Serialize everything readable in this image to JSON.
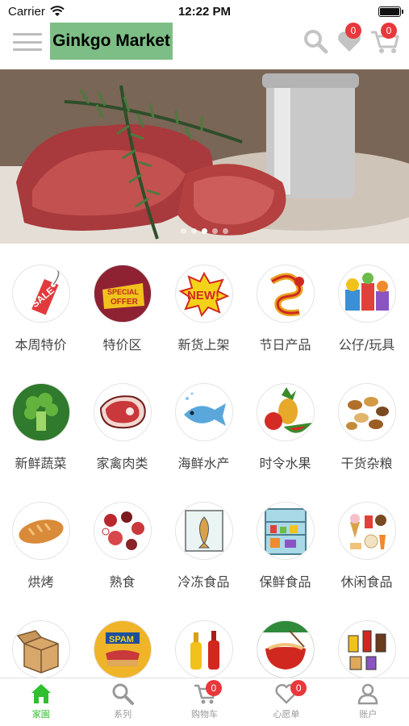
{
  "status_bar": {
    "carrier": "Carrier",
    "time": "12:22 PM"
  },
  "header": {
    "logo": "Ginkgo Market",
    "wishlist_count": "0",
    "cart_count": "0"
  },
  "banner": {
    "slide_count": 5,
    "active_slide": 3
  },
  "categories": [
    {
      "label": "本周特价",
      "icon": "sale-tag-icon"
    },
    {
      "label": "特价区",
      "icon": "special-offer-icon"
    },
    {
      "label": "新货上架",
      "icon": "new-burst-icon"
    },
    {
      "label": "节日产品",
      "icon": "dragon-icon"
    },
    {
      "label": "公仔/玩具",
      "icon": "toys-icon"
    },
    {
      "label": "新鲜蔬菜",
      "icon": "broccoli-icon"
    },
    {
      "label": "家禽肉类",
      "icon": "steak-icon"
    },
    {
      "label": "海鲜水产",
      "icon": "fish-icon"
    },
    {
      "label": "时令水果",
      "icon": "fruit-icon"
    },
    {
      "label": "干货杂粮",
      "icon": "nuts-icon"
    },
    {
      "label": "烘烤",
      "icon": "bread-icon"
    },
    {
      "label": "熟食",
      "icon": "deli-icon"
    },
    {
      "label": "冷冻食品",
      "icon": "frozen-fish-icon"
    },
    {
      "label": "保鲜食品",
      "icon": "fridge-icon"
    },
    {
      "label": "休闲食品",
      "icon": "snacks-icon"
    },
    {
      "label": "",
      "icon": "box-icon"
    },
    {
      "label": "",
      "icon": "spam-can-icon"
    },
    {
      "label": "",
      "icon": "sauce-bottles-icon"
    },
    {
      "label": "",
      "icon": "noodle-bowl-icon"
    },
    {
      "label": "",
      "icon": "drinks-icon"
    }
  ],
  "tabbar": {
    "tabs": [
      {
        "label": "家園",
        "icon": "home-icon",
        "active": true
      },
      {
        "label": "系列",
        "icon": "search-icon",
        "active": false
      },
      {
        "label": "购物车",
        "icon": "cart-icon",
        "active": false,
        "badge": "0"
      },
      {
        "label": "心愿单",
        "icon": "heart-icon",
        "active": false,
        "badge": "0"
      },
      {
        "label": "账户",
        "icon": "user-icon",
        "active": false
      }
    ]
  },
  "colors": {
    "logo_bg": "#7cbe85",
    "badge": "#e8383b",
    "active_tab": "#2fbf2f",
    "inactive_tab": "#999999"
  }
}
